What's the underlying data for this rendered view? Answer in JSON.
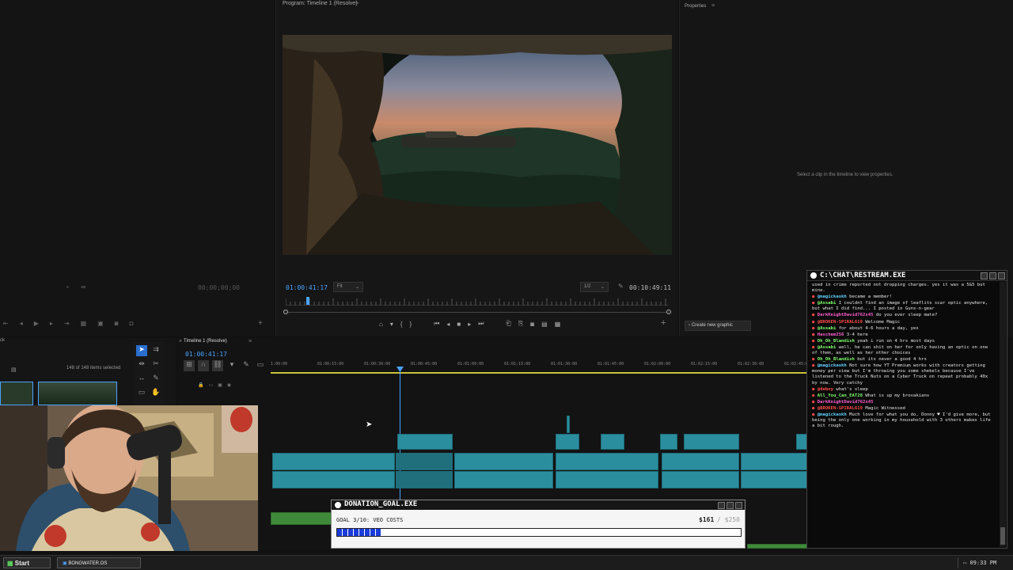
{
  "program": {
    "title": "Program: Timeline 1 (Resolve)",
    "timecode": "01:00:41:17",
    "fit": "Fit",
    "resolution": "1/2",
    "duration": "00:10:49:11"
  },
  "source": {
    "timecode": "00;00;00;00"
  },
  "properties": {
    "title": "Properties",
    "hint": "Select a clip in the timeline to view properties.",
    "create_graphic": "Create new graphic"
  },
  "project": {
    "count": "148 of 148 items selected"
  },
  "timeline": {
    "tab": "Timeline 1 (Resolve)",
    "timecode": "01:00:41:17",
    "ruler": [
      "1:00:00",
      "01:00:15:00",
      "01:00:30:00",
      "01:00:45:00",
      "01:01:00:00",
      "01:01:15:00",
      "01:01:30:00",
      "01:01:45:00",
      "01:02:00:00",
      "01:02:15:00",
      "01:02:30:00",
      "01:02:45:00"
    ]
  },
  "chat": {
    "title": "C:\\CHAT\\RESTREAM.EXE",
    "messages": [
      {
        "user": "",
        "text": "used in crime reported not dropping charges. yes it was a 5&5 but mine.",
        "color": "#ffffff"
      },
      {
        "user": "@magickaskh",
        "text": " became a member!",
        "color": "#5fd3ff"
      },
      {
        "user": "@Assabi",
        "text": " I couldnt find an image of leaflits scar optic anywhere, but what I did find... I posted in Guns-n-gear",
        "color": "#7dff6b"
      },
      {
        "user": "DarkKnightDavid762x45",
        "text": " do you ever sleep mate?",
        "color": "#ff5fd2"
      },
      {
        "user": "@BROKEN-SPIRAL619",
        "text": " Welcome Magic",
        "color": "#ff4a4a"
      },
      {
        "user": "@Assabi",
        "text": " for about 4-6 hours a day, yes",
        "color": "#7dff6b"
      },
      {
        "user": "Haschem256",
        "text": " 3-4 here",
        "color": "#ff5fd2"
      },
      {
        "user": "Oh_Oh_Blandish",
        "text": " yeah i run on 4 hrs most days",
        "color": "#7dff6b"
      },
      {
        "user": "@Assabi",
        "text": " well, he can shit on her for only having an optic on one of them, as well as her other choices",
        "color": "#7dff6b"
      },
      {
        "user": "Oh_Oh_Blandish",
        "text": " but its never a good 4 hrs",
        "color": "#7dff6b"
      },
      {
        "user": "@magickaskh",
        "text": " Not sure how YT Premium works with creators getting money per view but I'm throwing you some shekels because I've listened to the Truck Nuts on a Cyber Truck on repeat probably 40x by now. Very catchy",
        "color": "#5fd3ff"
      },
      {
        "user": "@deboy",
        "text": " what's sleep",
        "color": "#ff4a4a"
      },
      {
        "user": "All_You_Can_EAT28",
        "text": " What is up my brovakians",
        "color": "#7dff6b"
      },
      {
        "user": "DarkKnightDavid762x45",
        "text": "",
        "color": "#ff5fd2"
      },
      {
        "user": "@BROKEN-SPIRAL619",
        "text": " Magic Witnessed",
        "color": "#ff4a4a"
      },
      {
        "user": "@magickaskh",
        "text": " Much love for what you do, Donny ♥ I'd give more, but being the only one working in my household with 3 others makes life a bit rough.",
        "color": "#5fd3ff"
      }
    ]
  },
  "donation": {
    "title": "DONATION_GOAL.EXE",
    "goal": "GOAL 3/10: VEO COSTS",
    "amount": "$161",
    "target": "/ $250",
    "progress": 0.644
  },
  "taskbar": {
    "start": "Start",
    "os": "BONGWATER.OS",
    "clock": "09:33 PM"
  }
}
